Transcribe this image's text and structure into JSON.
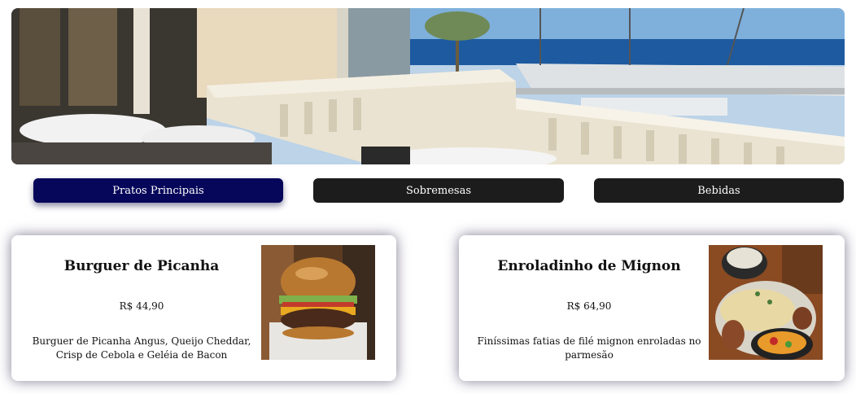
{
  "hero": {
    "image": "restaurant-terrace-harbor-photo"
  },
  "tabs": [
    {
      "label": "Pratos Principais",
      "active": true
    },
    {
      "label": "Sobremesas",
      "active": false
    },
    {
      "label": "Bebidas",
      "active": false
    }
  ],
  "cards": [
    {
      "title": "Burguer de Picanha",
      "price": "R$ 44,90",
      "description": "Burguer de Picanha Angus, Queijo Cheddar, Crisp de Cebola e Geléia de Bacon",
      "image": "burger-photo"
    },
    {
      "title": "Enroladinho de Mignon",
      "price": "R$ 64,90",
      "description": "Finíssimas fatias de filé mignon enroladas no parmesão",
      "image": "mignon-rolls-photo"
    }
  ],
  "colors": {
    "tab_active": "#06065a",
    "tab_inactive": "#1c1c1c",
    "tab_text": "#ffffff"
  }
}
